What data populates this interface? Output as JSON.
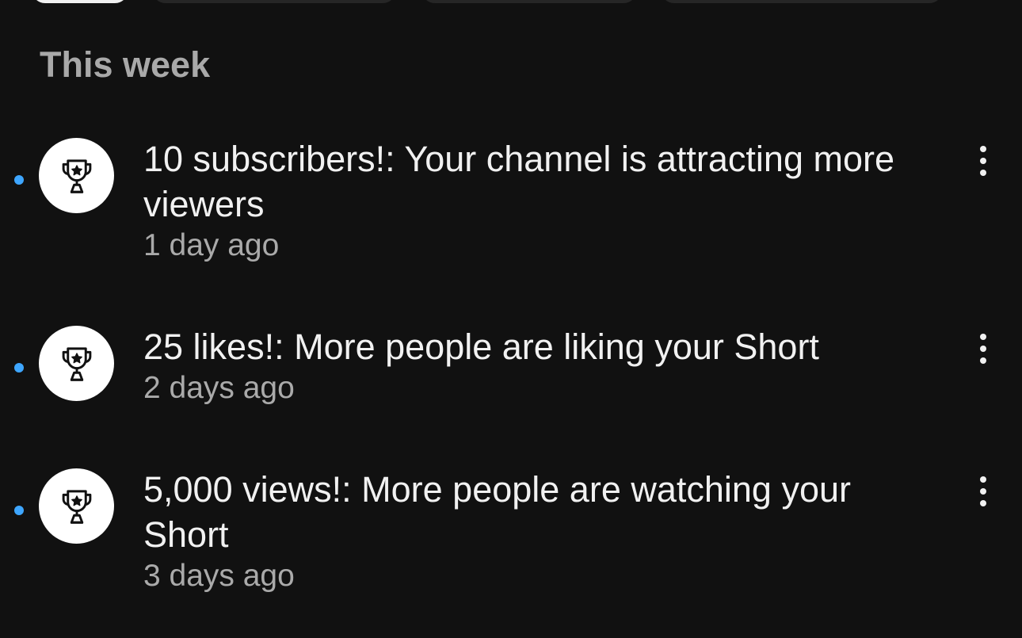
{
  "filter_chips": [
    {
      "label": "",
      "selected": true
    },
    {
      "label": "",
      "selected": false
    },
    {
      "label": "",
      "selected": false
    },
    {
      "label": "",
      "selected": false
    }
  ],
  "section": {
    "title": "This week"
  },
  "notifications": [
    {
      "title": "10 subscribers!: Your channel is attracting more viewers",
      "time": "1 day ago",
      "icon": "trophy-icon",
      "unread": true
    },
    {
      "title": "25 likes!: More people are liking your Short",
      "time": "2 days ago",
      "icon": "trophy-icon",
      "unread": true
    },
    {
      "title": "5,000 views!: More people are watching your Short",
      "time": "3 days ago",
      "icon": "trophy-icon",
      "unread": true
    }
  ],
  "colors": {
    "background": "#111111",
    "unread_dot": "#3ea6ff",
    "section_title": "#a9a9a9",
    "secondary_text": "#aaaaaa"
  }
}
